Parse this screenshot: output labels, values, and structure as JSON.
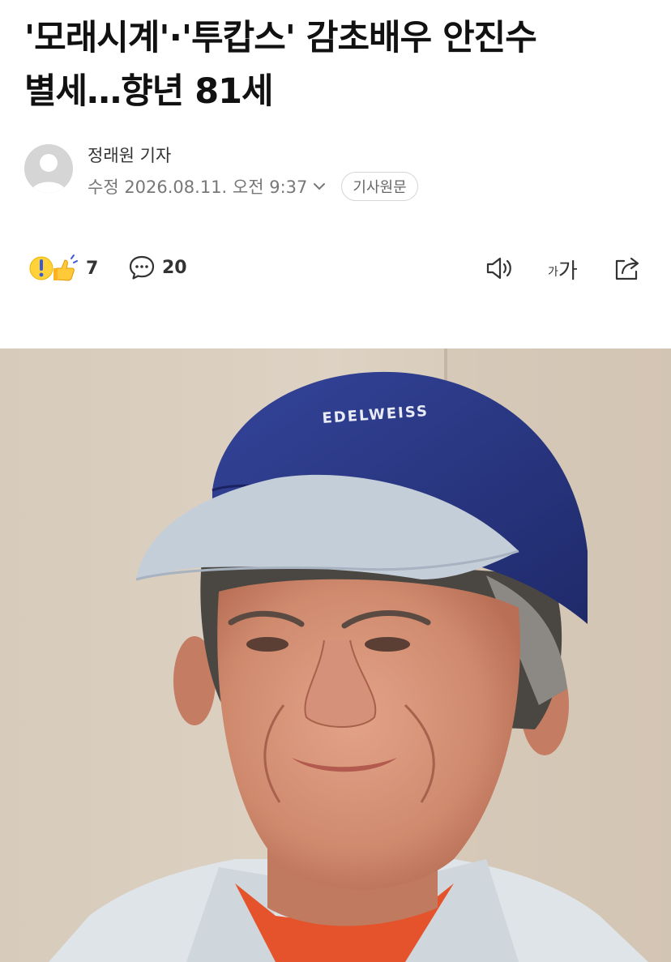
{
  "article": {
    "headline": "'모래시계'·'투캅스' 감초배우 안진수\n별세…향년 81세",
    "reporter": "정래원 기자",
    "updated": "수정 2026.08.11. 오전 9:37",
    "original_button": "기사원문"
  },
  "toolbar": {
    "reaction_count": "7",
    "comment_count": "20",
    "font_small": "가",
    "font_large": "가"
  },
  "photo": {
    "cap_logo_text": "EDELWEISS"
  },
  "icons": {
    "avatar": "default-user-icon",
    "date_dropdown": "chevron-down-icon",
    "reaction": "reaction-emoji-icons",
    "comment": "speech-bubble-icon",
    "audio": "speaker-icon",
    "share": "share-arrow-icon"
  },
  "colors": {
    "cap": "#2c3a86",
    "cap_brim": "#c4ced9",
    "shirt": "#e4532b",
    "background_wall": "#d9cdbd"
  }
}
